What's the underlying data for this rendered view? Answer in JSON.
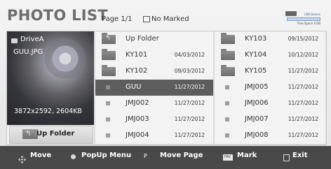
{
  "header": {
    "title": "PHOTO LIST",
    "page_info": "Page 1/1",
    "marked_label": "No Marked",
    "usb_device_label": "USB Device",
    "usb_free_space": "Free Space 4 GB"
  },
  "preview": {
    "drive_label": "DriveA",
    "filename": "GUU.JPG",
    "resolution": "3872x2592, 2604KB"
  },
  "up_folder_button": {
    "label": "Up Folder"
  },
  "files_left": [
    {
      "name": "Up Folder",
      "date": "",
      "type": "up-folder"
    },
    {
      "name": "KY101",
      "date": "04/03/2012",
      "type": "folder"
    },
    {
      "name": "KY102",
      "date": "09/03/2012",
      "type": "folder"
    },
    {
      "name": "GUU",
      "date": "11/27/2012",
      "type": "file",
      "selected": true
    },
    {
      "name": "JMJ002",
      "date": "11/27/2012",
      "type": "file"
    },
    {
      "name": "JMJ003",
      "date": "11/27/2012",
      "type": "file"
    },
    {
      "name": "JMJ004",
      "date": "11/27/2012",
      "type": "file"
    }
  ],
  "files_right": [
    {
      "name": "KY103",
      "date": "09/15/2012",
      "type": "folder"
    },
    {
      "name": "KY104",
      "date": "10/12/2012",
      "type": "folder"
    },
    {
      "name": "KY105",
      "date": "11/27/2012",
      "type": "folder"
    },
    {
      "name": "JMJ005",
      "date": "11/27/2012",
      "type": "file"
    },
    {
      "name": "JMJ006",
      "date": "11/27/2012",
      "type": "file"
    },
    {
      "name": "JMJ007",
      "date": "11/27/2012",
      "type": "file"
    },
    {
      "name": "JMJ008",
      "date": "11/27/2012",
      "type": "file"
    }
  ],
  "bottom_bar": {
    "move": "Move",
    "popup_menu": "PopUp Menu",
    "move_page": "Move Page",
    "mark": "Mark",
    "exit": "Exit",
    "fav_key_label": "FAV",
    "page_key_label": "P"
  },
  "colors": {
    "background": "#e9e9e9",
    "selected_row": "#5d5d5d",
    "bottom_bar": "#494949"
  }
}
